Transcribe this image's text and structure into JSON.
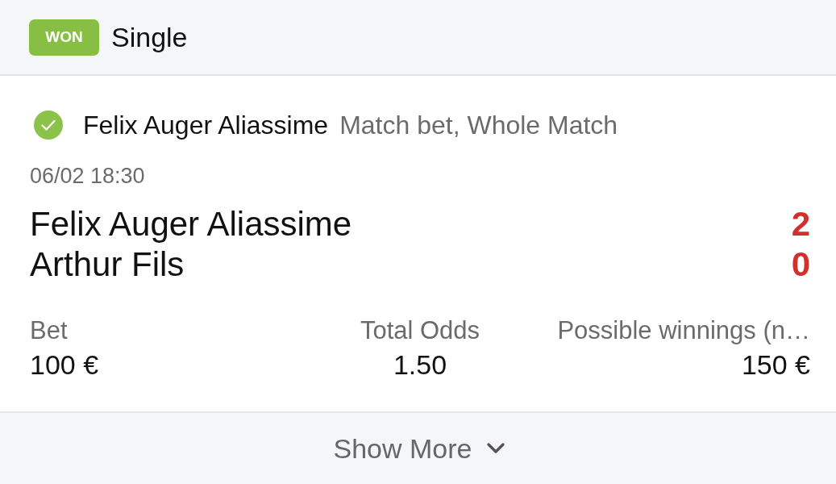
{
  "header": {
    "status_badge": {
      "label": "WON",
      "kind": "won"
    },
    "bet_type": "Single"
  },
  "selection": {
    "won": true,
    "name": "Felix Auger Aliassime",
    "market": "Match bet, Whole Match"
  },
  "event": {
    "datetime": "06/02 18:30",
    "participants": [
      {
        "name": "Felix Auger Aliassime",
        "score": "2"
      },
      {
        "name": "Arthur Fils",
        "score": "0"
      }
    ]
  },
  "summary": [
    {
      "label": "Bet",
      "value": "100 €"
    },
    {
      "label": "Total Odds",
      "value": "1.50"
    },
    {
      "label": "Possible winnings (n…",
      "value": "150 €"
    }
  ],
  "footer": {
    "show_more": "Show More"
  }
}
